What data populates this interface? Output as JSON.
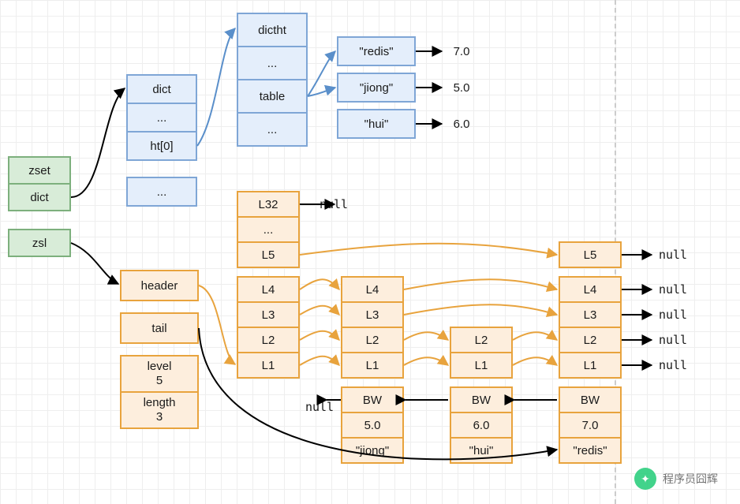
{
  "zset_struct": {
    "title": "zset",
    "members": [
      "dict",
      "zsl"
    ]
  },
  "dict_struct": {
    "title": "dict",
    "rows": [
      "...",
      "ht[0]",
      "..."
    ]
  },
  "dictht_struct": {
    "title": "dictht",
    "rows": [
      "...",
      "table",
      "..."
    ]
  },
  "hash_entries": [
    {
      "key": "\"redis\"",
      "value": "7.0"
    },
    {
      "key": "\"jiong\"",
      "value": "5.0"
    },
    {
      "key": "\"hui\"",
      "value": "6.0"
    }
  ],
  "zsl_struct": {
    "rows": [
      "header",
      "tail",
      "level",
      "length"
    ],
    "level_value": "5",
    "length_value": "3"
  },
  "header_levels": [
    "L32",
    "...",
    "L5",
    "L4",
    "L3",
    "L2",
    "L1"
  ],
  "header_null": "null",
  "nodes": [
    {
      "levels": [
        "L4",
        "L3",
        "L2",
        "L1"
      ],
      "bw": "BW",
      "bw_target": "null",
      "score": "5.0",
      "obj": "\"jiong\""
    },
    {
      "levels": [
        "L2",
        "L1"
      ],
      "bw": "BW",
      "score": "6.0",
      "obj": "\"hui\""
    },
    {
      "levels": [
        "L5",
        "L4",
        "L3",
        "L2",
        "L1"
      ],
      "bw": "BW",
      "score": "7.0",
      "obj": "\"redis\""
    }
  ],
  "right_nulls": [
    "null",
    "null",
    "null",
    "null",
    "null"
  ],
  "watermark": "程序员囧辉"
}
